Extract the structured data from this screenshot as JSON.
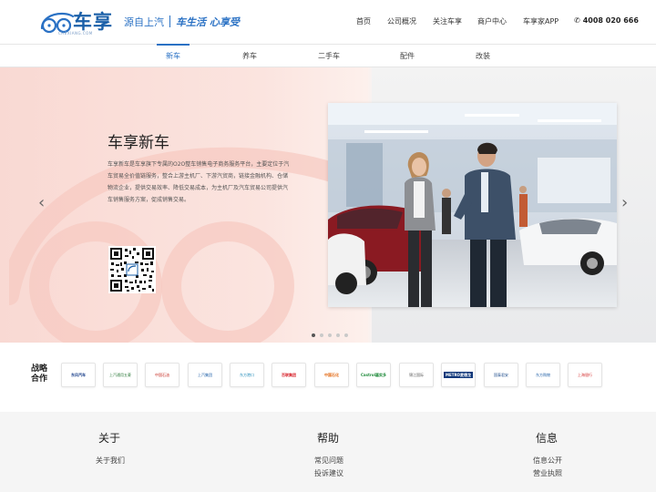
{
  "header": {
    "logo_text": "车享",
    "logo_sub": "CHEXIANG.COM",
    "slogan_source": "源自上汽",
    "slogan_tagline": "车生活  心享受",
    "nav": [
      "首页",
      "公司概况",
      "关注车享",
      "商户中心",
      "车享家APP"
    ],
    "phone": "4008 020 666"
  },
  "subnav": {
    "items": [
      "新车",
      "养车",
      "二手车",
      "配件",
      "改装"
    ],
    "active": "新车"
  },
  "hero": {
    "title": "车享新车",
    "description": "车享新车是车享旗下专属的O2O整车销售电子商务服务平台，主要定位于汽车贸易全价值链服务，整合上游主机厂、下游汽贸商，链接金融机构、仓储物流企业，提供交易效率、降低交易成本，为主机厂及汽车贸易公司提供汽车销售服务方案，促成销售交易。",
    "slide_count": 5,
    "active_slide": 1
  },
  "partners": {
    "label": "战略合作",
    "logos": [
      "东风汽车",
      "上汽通用五菱",
      "中国石油",
      "上汽集团",
      "东方港口",
      "百联集团",
      "中国石化",
      "Castrol嘉实多",
      "锦江国际",
      "METRO麦德龙",
      "国泰君安",
      "东方购物",
      "上海银行"
    ]
  },
  "footer": {
    "columns": [
      {
        "title": "关于",
        "links": [
          "关于我们"
        ]
      },
      {
        "title": "帮助",
        "links": [
          "常见问题",
          "投诉建议"
        ]
      },
      {
        "title": "信息",
        "links": [
          "信息公开",
          "营业执照"
        ]
      }
    ]
  },
  "colors": {
    "brand_blue": "#2a71c4",
    "hero_pink": "#f9d9d3",
    "footer_bg": "#f5f5f5"
  }
}
